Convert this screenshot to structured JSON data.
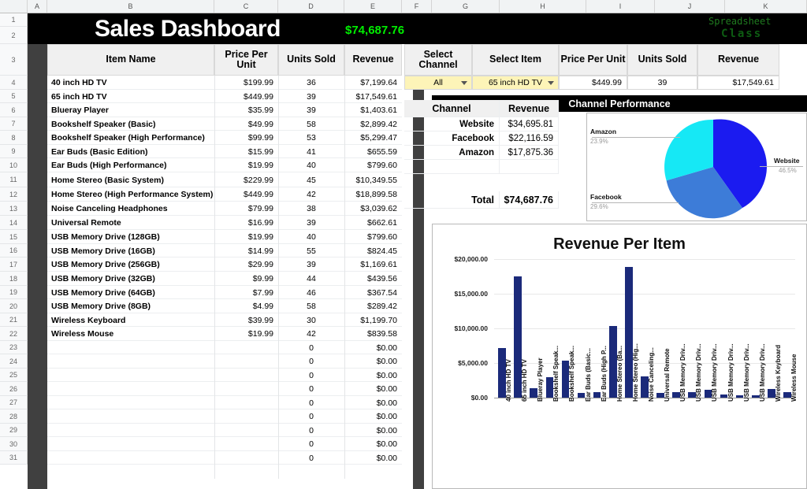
{
  "app": {
    "type": "spreadsheet",
    "columns": [
      "A",
      "B",
      "C",
      "D",
      "E",
      "F",
      "G",
      "H",
      "I",
      "J",
      "K"
    ],
    "rows": [
      "1",
      "2",
      "3",
      "4",
      "5",
      "6",
      "7",
      "8",
      "9",
      "10",
      "11",
      "12",
      "13",
      "14",
      "15",
      "16",
      "17",
      "18",
      "19",
      "20",
      "21",
      "22",
      "23",
      "24",
      "25",
      "26",
      "27",
      "28",
      "29",
      "30",
      "31"
    ]
  },
  "header": {
    "title": "Sales Dashboard",
    "grand_total": "$74,687.76",
    "logo_line1": "Spreadsheet",
    "logo_line2": "Class",
    "title_bg": "#000000",
    "total_color": "#00ee00",
    "logo_color": "#1f7a1f"
  },
  "item_table": {
    "columns": [
      "Item Name",
      "Price Per Unit",
      "Units Sold",
      "Revenue"
    ],
    "rows": [
      {
        "name": "40 inch HD TV",
        "price": "$199.99",
        "units": "36",
        "revenue": "$7,199.64"
      },
      {
        "name": "65 inch HD TV",
        "price": "$449.99",
        "units": "39",
        "revenue": "$17,549.61"
      },
      {
        "name": "Blueray Player",
        "price": "$35.99",
        "units": "39",
        "revenue": "$1,403.61"
      },
      {
        "name": "Bookshelf Speaker (Basic)",
        "price": "$49.99",
        "units": "58",
        "revenue": "$2,899.42"
      },
      {
        "name": "Bookshelf Speaker (High Performance)",
        "price": "$99.99",
        "units": "53",
        "revenue": "$5,299.47"
      },
      {
        "name": "Ear Buds (Basic Edition)",
        "price": "$15.99",
        "units": "41",
        "revenue": "$655.59"
      },
      {
        "name": "Ear Buds (High Performance)",
        "price": "$19.99",
        "units": "40",
        "revenue": "$799.60"
      },
      {
        "name": "Home Stereo (Basic System)",
        "price": "$229.99",
        "units": "45",
        "revenue": "$10,349.55"
      },
      {
        "name": "Home Stereo (High Performance System)",
        "price": "$449.99",
        "units": "42",
        "revenue": "$18,899.58"
      },
      {
        "name": "Noise Canceling Headphones",
        "price": "$79.99",
        "units": "38",
        "revenue": "$3,039.62"
      },
      {
        "name": "Universal Remote",
        "price": "$16.99",
        "units": "39",
        "revenue": "$662.61"
      },
      {
        "name": "USB Memory Drive (128GB)",
        "price": "$19.99",
        "units": "40",
        "revenue": "$799.60"
      },
      {
        "name": "USB Memory Drive (16GB)",
        "price": "$14.99",
        "units": "55",
        "revenue": "$824.45"
      },
      {
        "name": "USB Memory Drive (256GB)",
        "price": "$29.99",
        "units": "39",
        "revenue": "$1,169.61"
      },
      {
        "name": "USB Memory Drive (32GB)",
        "price": "$9.99",
        "units": "44",
        "revenue": "$439.56"
      },
      {
        "name": "USB Memory Drive (64GB)",
        "price": "$7.99",
        "units": "46",
        "revenue": "$367.54"
      },
      {
        "name": "USB Memory Drive (8GB)",
        "price": "$4.99",
        "units": "58",
        "revenue": "$289.42"
      },
      {
        "name": "Wireless Keyboard",
        "price": "$39.99",
        "units": "30",
        "revenue": "$1,199.70"
      },
      {
        "name": "Wireless Mouse",
        "price": "$19.99",
        "units": "42",
        "revenue": "$839.58"
      },
      {
        "name": "",
        "price": "",
        "units": "0",
        "revenue": "$0.00"
      },
      {
        "name": "",
        "price": "",
        "units": "0",
        "revenue": "$0.00"
      },
      {
        "name": "",
        "price": "",
        "units": "0",
        "revenue": "$0.00"
      },
      {
        "name": "",
        "price": "",
        "units": "0",
        "revenue": "$0.00"
      },
      {
        "name": "",
        "price": "",
        "units": "0",
        "revenue": "$0.00"
      },
      {
        "name": "",
        "price": "",
        "units": "0",
        "revenue": "$0.00"
      },
      {
        "name": "",
        "price": "",
        "units": "0",
        "revenue": "$0.00"
      },
      {
        "name": "",
        "price": "",
        "units": "0",
        "revenue": "$0.00"
      },
      {
        "name": "",
        "price": "",
        "units": "0",
        "revenue": "$0.00"
      }
    ]
  },
  "selector": {
    "columns": [
      "Select Channel",
      "Select Item",
      "Price Per Unit",
      "Units Sold",
      "Revenue"
    ],
    "channel_value": "All",
    "item_value": "65 inch HD TV",
    "price": "$449.99",
    "units": "39",
    "revenue": "$17,549.61",
    "dropdown_bg": "#fdf4b8"
  },
  "channel_panel": {
    "banner": "Channel Performance",
    "columns": [
      "Channel",
      "Revenue"
    ],
    "rows": [
      {
        "channel": "Website",
        "revenue": "$34,695.81"
      },
      {
        "channel": "Facebook",
        "revenue": "$22,116.59"
      },
      {
        "channel": "Amazon",
        "revenue": "$17,875.36"
      }
    ],
    "total_label": "Total",
    "total_value": "$74,687.76"
  },
  "chart_data": [
    {
      "type": "pie",
      "title": "",
      "labels": [
        "Website",
        "Facebook",
        "Amazon"
      ],
      "values": [
        34695.81,
        22116.59,
        17875.36
      ],
      "percent_labels": [
        "46.5%",
        "29.6%",
        "23.9%"
      ],
      "colors": [
        "#1b1bf0",
        "#3d7cd8",
        "#16e8f5"
      ],
      "legend": "labels-with-leader-lines"
    },
    {
      "type": "bar",
      "title": "Revenue Per Item",
      "xlabel": "",
      "ylabel": "",
      "ylim": [
        0,
        20000
      ],
      "ytick_labels": [
        "$0.00",
        "$5,000.00",
        "$10,000.00",
        "$15,000.00",
        "$20,000.00"
      ],
      "ytick_values": [
        0,
        5000,
        10000,
        15000,
        20000
      ],
      "grid": true,
      "bar_color": "#1b2a7a",
      "categories": [
        "40 inch HD TV",
        "65 inch HD TV",
        "Blueray Player",
        "Bookshelf Speak...",
        "Bookshelf Speak...",
        "Ear Buds (Basic...",
        "Ear Buds (High P...",
        "Home Stereo (Ba...",
        "Home Stereo (Hig...",
        "Noise Canceling...",
        "Universal Remote",
        "USB Memory Driv...",
        "USB Memory Driv...",
        "USB Memory Driv...",
        "USB Memory Driv...",
        "USB Memory Driv...",
        "USB Memory Driv...",
        "Wireless Keyboard",
        "Wireless Mouse"
      ],
      "values": [
        7199.64,
        17549.61,
        1403.61,
        2899.42,
        5299.47,
        655.59,
        799.6,
        10349.55,
        18899.58,
        3039.62,
        662.61,
        799.6,
        824.45,
        1169.61,
        439.56,
        367.54,
        289.42,
        1199.7,
        839.58
      ]
    }
  ]
}
